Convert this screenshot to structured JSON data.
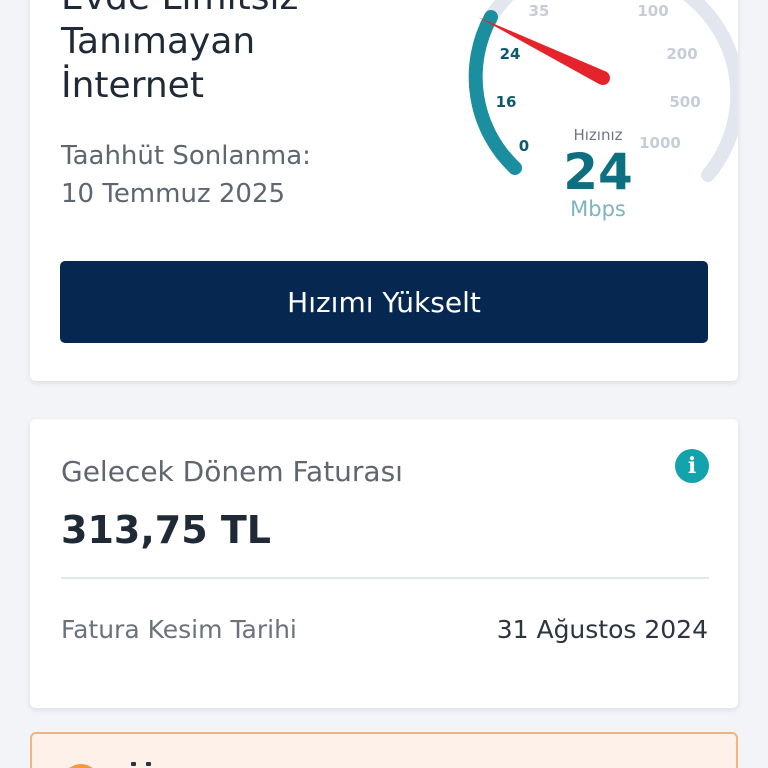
{
  "plan": {
    "title_lines": [
      "Evde Limitsiz",
      "Tanımayan",
      "İnternet"
    ],
    "commitment_label": "Taahhüt Sonlanma:",
    "commitment_date": "10 Temmuz 2025"
  },
  "speed_gauge": {
    "title": "Hızınız",
    "value": "24",
    "unit": "Mbps",
    "current_speed": 24,
    "current_scale_ticks": [
      "0",
      "16",
      "24",
      "35"
    ],
    "upgrade_scale_ticks": [
      "100",
      "200",
      "500",
      "1000"
    ],
    "colors": {
      "active_arc": "#1b8ea0",
      "inactive_arc": "#e2e6ef",
      "needle": "#e5232b",
      "tick_active": "#0e5a6b",
      "tick_inactive": "#c7ccd6"
    }
  },
  "upgrade_button": {
    "label": "Hızımı Yükselt"
  },
  "bill": {
    "label": "Gelecek Dönem Faturası",
    "amount": "313,75 TL",
    "info_icon": "info-icon",
    "cutoff_label": "Fatura Kesim Tarihi",
    "cutoff_date": "31 Ağustos 2024"
  },
  "warning": {
    "icon": "warning-icon",
    "accent_color": "#f39a3e",
    "background_color": "#fdf1e9"
  }
}
